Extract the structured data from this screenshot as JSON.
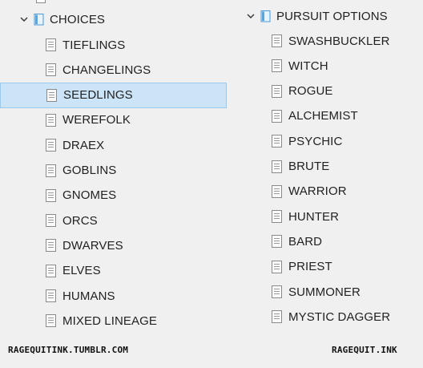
{
  "left_tree": {
    "folder_label": "CHOICES",
    "items": [
      {
        "label": "TIEFLINGS"
      },
      {
        "label": "CHANGELINGS"
      },
      {
        "label": "SEEDLINGS",
        "selected": true
      },
      {
        "label": "WEREFOLK"
      },
      {
        "label": "DRAEX"
      },
      {
        "label": "GOBLINS"
      },
      {
        "label": "GNOMES"
      },
      {
        "label": "ORCS"
      },
      {
        "label": "DWARVES"
      },
      {
        "label": "ELVES"
      },
      {
        "label": "HUMANS"
      },
      {
        "label": "MIXED LINEAGE"
      }
    ]
  },
  "right_tree": {
    "folder_label": "PURSUIT OPTIONS",
    "items": [
      {
        "label": "SWASHBUCKLER"
      },
      {
        "label": "WITCH"
      },
      {
        "label": "ROGUE"
      },
      {
        "label": "ALCHEMIST"
      },
      {
        "label": "PSYCHIC"
      },
      {
        "label": "BRUTE"
      },
      {
        "label": "WARRIOR"
      },
      {
        "label": "HUNTER"
      },
      {
        "label": "BARD"
      },
      {
        "label": "PRIEST"
      },
      {
        "label": "SUMMONER"
      },
      {
        "label": "MYSTIC DAGGER"
      }
    ]
  },
  "footer": {
    "left": "RAGEQUITINK.TUMBLR.COM",
    "right": "RAGEQUIT.INK"
  },
  "colors": {
    "background": "#f0f0f0",
    "selection_fill": "#cce4f7",
    "selection_border": "#99c9ef",
    "folder_icon": "#5aa7e0"
  },
  "icons": {
    "folder": "document-folder-icon",
    "item": "document-icon",
    "expander": "chevron-down-icon"
  }
}
